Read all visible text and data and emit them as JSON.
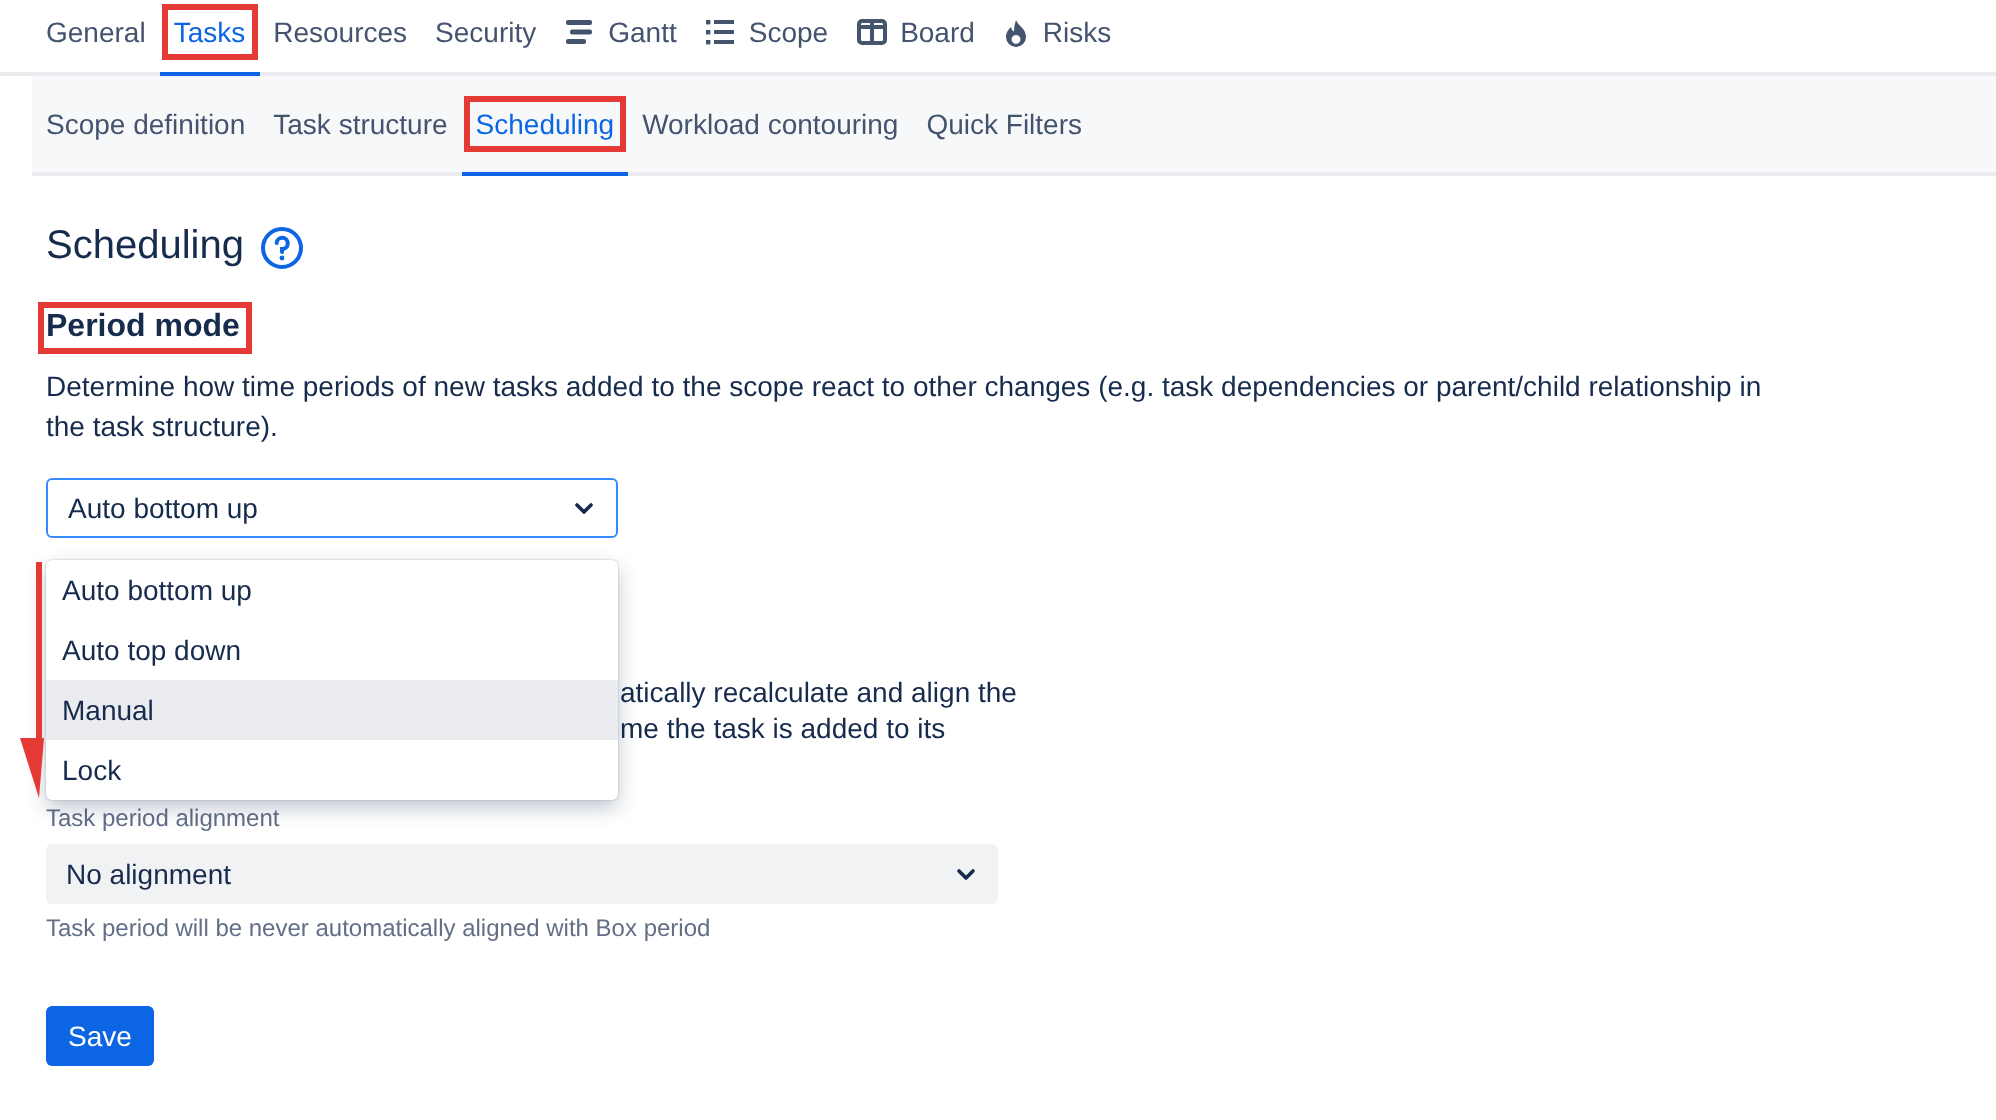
{
  "tabs": [
    {
      "label": "General",
      "kind": "plain",
      "selected": false,
      "highlighted": false
    },
    {
      "label": "Tasks",
      "kind": "plain",
      "selected": true,
      "highlighted": true
    },
    {
      "label": "Resources",
      "kind": "plain",
      "selected": false,
      "highlighted": false
    },
    {
      "label": "Security",
      "kind": "plain",
      "selected": false,
      "highlighted": false
    },
    {
      "label": "Gantt",
      "kind": "gantt",
      "selected": false,
      "highlighted": false
    },
    {
      "label": "Scope",
      "kind": "list",
      "selected": false,
      "highlighted": false
    },
    {
      "label": "Board",
      "kind": "board",
      "selected": false,
      "highlighted": false
    },
    {
      "label": "Risks",
      "kind": "flame",
      "selected": false,
      "highlighted": false
    }
  ],
  "subtabs": [
    {
      "label": "Scope definition",
      "selected": false,
      "highlighted": false
    },
    {
      "label": "Task structure",
      "selected": false,
      "highlighted": false
    },
    {
      "label": "Scheduling",
      "selected": true,
      "highlighted": true
    },
    {
      "label": "Workload contouring",
      "selected": false,
      "highlighted": false
    },
    {
      "label": "Quick Filters",
      "selected": false,
      "highlighted": false
    }
  ],
  "page_title": "Scheduling",
  "section": {
    "title": "Period mode",
    "highlighted": true,
    "description": "Determine how time periods of new tasks added to the scope react to other changes (e.g. task dependencies or parent/child relationship in the task structure).",
    "select": {
      "value": "Auto bottom up",
      "options": [
        {
          "label": "Auto bottom up",
          "highlighted": false
        },
        {
          "label": "Auto top down",
          "highlighted": false
        },
        {
          "label": "Manual",
          "highlighted": true
        },
        {
          "label": "Lock",
          "highlighted": false
        }
      ]
    }
  },
  "covered_text": [
    "atically recalculate and align the",
    "me the task is added to its"
  ],
  "alignment": {
    "label": "Task period alignment",
    "value": "No alignment",
    "hint": "Task period will be never automatically aligned with Box period"
  },
  "save_button": "Save"
}
